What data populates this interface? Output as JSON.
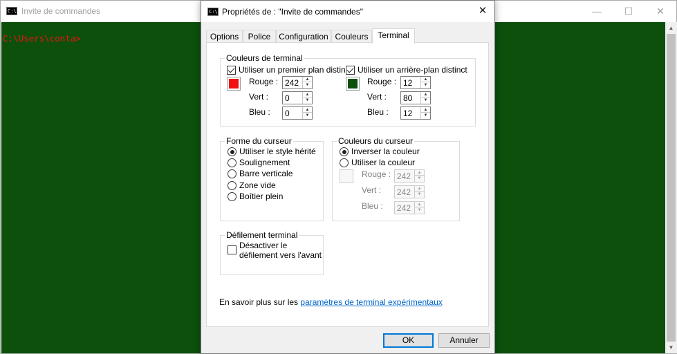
{
  "console": {
    "title": "Invite de commandes",
    "icon": "console-icon",
    "icon_text": "C:\\",
    "prompt": "C:\\Users\\conta>",
    "background_color": "#0c500c",
    "text_color": "#f21212",
    "minimize": "—",
    "maximize": "☐",
    "close": "✕"
  },
  "dialog": {
    "title": "Propriétés de : \"Invite de commandes\"",
    "close": "✕",
    "tabs": [
      {
        "label": "Options"
      },
      {
        "label": "Police"
      },
      {
        "label": "Configuration"
      },
      {
        "label": "Couleurs"
      },
      {
        "label": "Terminal",
        "active": true
      }
    ],
    "terminal_colors": {
      "legend": "Couleurs de terminal",
      "foreground": {
        "checkbox_label": "Utiliser un premier plan distinct",
        "checked": true,
        "swatch_color": "#f21212",
        "red_label": "Rouge :",
        "red": "242",
        "green_label": "Vert :",
        "green": "0",
        "blue_label": "Bleu :",
        "blue": "0"
      },
      "background": {
        "checkbox_label": "Utiliser un arrière-plan distinct",
        "checked": true,
        "swatch_color": "#0c500c",
        "red_label": "Rouge :",
        "red": "12",
        "green_label": "Vert :",
        "green": "80",
        "blue_label": "Bleu :",
        "blue": "12"
      }
    },
    "cursor_shape": {
      "legend": "Forme du curseur",
      "options": [
        {
          "label": "Utiliser le style hérité",
          "selected": true
        },
        {
          "label": "Soulignement",
          "selected": false
        },
        {
          "label": "Barre verticale",
          "selected": false
        },
        {
          "label": "Zone vide",
          "selected": false
        },
        {
          "label": "Boîtier plein",
          "selected": false
        }
      ]
    },
    "cursor_colors": {
      "legend": "Couleurs du curseur",
      "options": [
        {
          "label": "Inverser la couleur",
          "selected": true
        },
        {
          "label": "Utiliser la couleur",
          "selected": false
        }
      ],
      "red_label": "Rouge :",
      "red": "242",
      "green_label": "Vert :",
      "green": "242",
      "blue_label": "Bleu :",
      "blue": "242"
    },
    "scrolling": {
      "legend": "Défilement terminal",
      "checkbox_label_line1": "Désactiver le",
      "checkbox_label_line2": "défilement vers l'avant",
      "checked": false
    },
    "learn_more_prefix": "En savoir plus sur les ",
    "learn_more_link": "paramètres de terminal expérimentaux",
    "ok": "OK",
    "cancel": "Annuler"
  }
}
